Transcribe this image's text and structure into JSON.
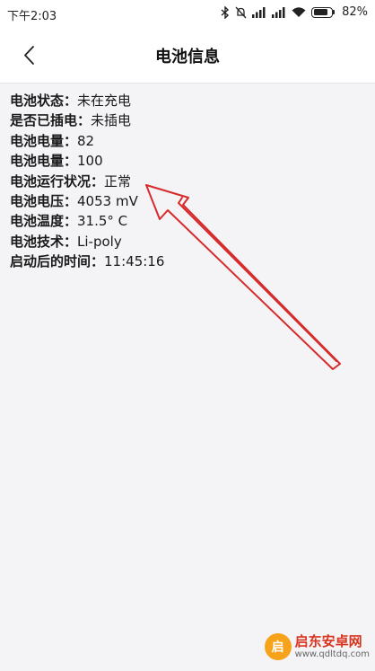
{
  "status_bar": {
    "time": "下午2:03",
    "battery_percent": "82%",
    "battery_level": 0.82,
    "icons": [
      "bluetooth-icon",
      "mute-icon",
      "signal-icon",
      "signal-icon",
      "wifi-icon",
      "battery-icon"
    ]
  },
  "header": {
    "title": "电池信息",
    "back_icon": "chevron-left-icon"
  },
  "battery_info": [
    {
      "label": "电池状态：",
      "value": "未在充电"
    },
    {
      "label": "是否已插电：",
      "value": "未插电"
    },
    {
      "label": "电池电量：",
      "value": "82"
    },
    {
      "label": "电池电量：",
      "value": "100"
    },
    {
      "label": "电池运行状况：",
      "value": "正常"
    },
    {
      "label": "电池电压：",
      "value": "4053 mV"
    },
    {
      "label": "电池温度：",
      "value": "31.5° C"
    },
    {
      "label": "电池技术：",
      "value": "Li-poly"
    },
    {
      "label": "启动后的时间：",
      "value": "11:45:16"
    }
  ],
  "annotation": {
    "arrow_color": "#d62b2b"
  },
  "watermark": {
    "logo_text": "启",
    "title": "启东安卓网",
    "url": "www.qdltdq.com"
  }
}
